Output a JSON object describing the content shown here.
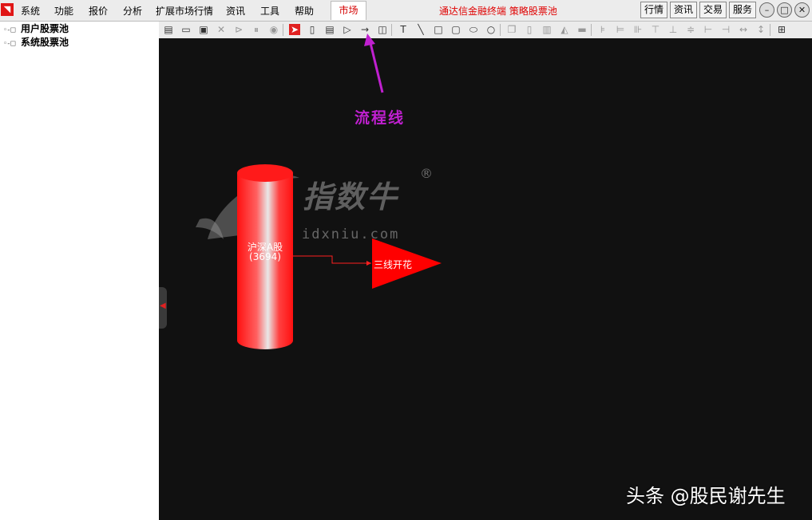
{
  "menu": {
    "items": [
      "系统",
      "功能",
      "报价",
      "分析",
      "扩展市场行情",
      "资讯",
      "工具",
      "帮助"
    ],
    "active_tab": "市场"
  },
  "window_title": "通达信金融终端  策略股票池",
  "quick_buttons": [
    "行情",
    "资讯",
    "交易",
    "服务"
  ],
  "tree": {
    "items": [
      "用户股票池",
      "系统股票池"
    ]
  },
  "toolbar_icons": [
    "new-icon",
    "open-icon",
    "save-icon",
    "delete-icon",
    "play-icon",
    "pause-icon",
    "stop-icon",
    "select-arrow-icon",
    "cylinder-icon",
    "list-icon",
    "triangle-icon",
    "flow-line-icon",
    "link-box-icon",
    "text-icon",
    "line-icon",
    "rectangle-icon",
    "rounded-rectangle-icon",
    "ellipse-icon",
    "circle-icon",
    "copy-icon",
    "paste-icon",
    "trash-icon",
    "fill-icon",
    "line-style-icon",
    "align-left-icon",
    "align-right-icon",
    "align-center-icon",
    "align-top-icon",
    "align-bottom-icon",
    "align-middle-icon",
    "distribute-horizontal-icon",
    "distribute-vertical-icon",
    "same-width-icon",
    "same-height-icon",
    "grid-icon"
  ],
  "annotation": "流程线",
  "watermark": {
    "brand": "指数牛",
    "registered": "®",
    "url": "idxniu.com"
  },
  "diagram": {
    "cylinder": {
      "label": "沪深A股",
      "count": "(3694)",
      "color": "#ff1a1a"
    },
    "triangle": {
      "label": "三线开花",
      "color": "#ff0000"
    }
  },
  "footer": "头条 @股民谢先生",
  "colors": {
    "accent_red": "#e00000",
    "annotation_purple": "#c020d0",
    "canvas_bg": "#111111"
  }
}
